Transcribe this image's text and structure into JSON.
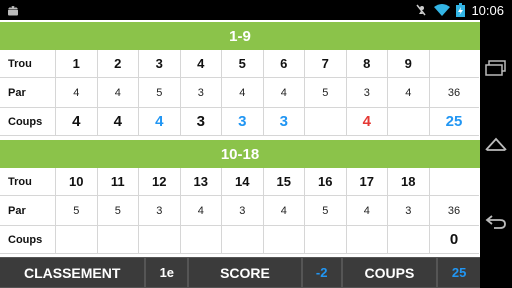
{
  "status_bar": {
    "time": "10:06",
    "icons": [
      "android-icon",
      "mute-icon",
      "wifi-icon",
      "battery-icon"
    ]
  },
  "front": {
    "title": "1-9",
    "trou_label": "Trou",
    "par_label": "Par",
    "coups_label": "Coups",
    "holes": [
      "1",
      "2",
      "3",
      "4",
      "5",
      "6",
      "7",
      "8",
      "9"
    ],
    "par": [
      "4",
      "4",
      "5",
      "3",
      "4",
      "4",
      "5",
      "3",
      "4"
    ],
    "par_total": "36",
    "coups": [
      "4",
      "4",
      "4",
      "3",
      "3",
      "3",
      "",
      "4",
      ""
    ],
    "coups_colors": [
      "#111111",
      "#111111",
      "#2196f3",
      "#111111",
      "#2196f3",
      "#2196f3",
      "#111111",
      "#e53935",
      "#111111"
    ],
    "coups_total": "25",
    "coups_total_color": "#2196f3"
  },
  "back": {
    "title": "10-18",
    "trou_label": "Trou",
    "par_label": "Par",
    "coups_label": "Coups",
    "holes": [
      "10",
      "11",
      "12",
      "13",
      "14",
      "15",
      "16",
      "17",
      "18"
    ],
    "par": [
      "5",
      "5",
      "3",
      "4",
      "3",
      "4",
      "5",
      "4",
      "3"
    ],
    "par_total": "36",
    "coups": [
      "",
      "",
      "",
      "",
      "",
      "",
      "",
      "",
      ""
    ],
    "coups_total": "0",
    "coups_total_color": "#111111"
  },
  "bottom_bar": {
    "classement_label": "CLASSEMENT",
    "classement_value": "1e",
    "score_label": "SCORE",
    "score_value": "-2",
    "coups_label": "COUPS",
    "coups_value": "25",
    "value_color": "#2196f3"
  },
  "colors": {
    "header_green": "#8bc34a",
    "accent_blue": "#2196f3",
    "red": "#e53935",
    "bottom_bg": "#3b3b3b"
  }
}
